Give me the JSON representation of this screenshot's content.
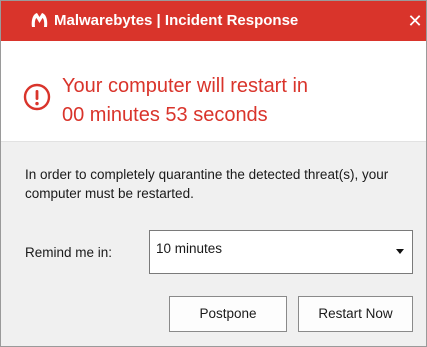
{
  "window": {
    "title": "Malwarebytes | Incident Response",
    "close_glyph": "✕",
    "logo_icon": "malwarebytes-logo",
    "accent_color": "#d9342b"
  },
  "alert": {
    "icon": "exclamation-circle-icon",
    "line1": "Your computer will restart in",
    "line2": "00 minutes 53 seconds"
  },
  "body": {
    "message": "In order to completely quarantine the detected threat(s), your computer must be restarted.",
    "remind_label": "Remind me in:",
    "remind_select": {
      "selected": "10 minutes"
    },
    "buttons": {
      "postpone": "Postpone",
      "restart_now": "Restart Now"
    }
  }
}
